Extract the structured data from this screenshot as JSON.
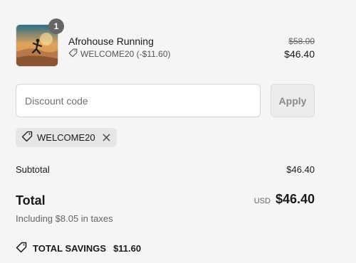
{
  "line_item": {
    "quantity": "1",
    "name": "Afrohouse Running",
    "discount_text": "WELCOME20 (-$11.60)",
    "price_original": "$58.00",
    "price_discounted": "$46.40"
  },
  "discount": {
    "placeholder": "Discount code",
    "apply_label": "Apply",
    "applied_code": "WELCOME20"
  },
  "summary": {
    "subtotal_label": "Subtotal",
    "subtotal_value": "$46.40",
    "total_label": "Total",
    "currency": "USD",
    "total_value": "$46.40",
    "taxes_note": "Including $8.05 in taxes",
    "savings_label": "TOTAL SAVINGS",
    "savings_value": "$11.60"
  }
}
